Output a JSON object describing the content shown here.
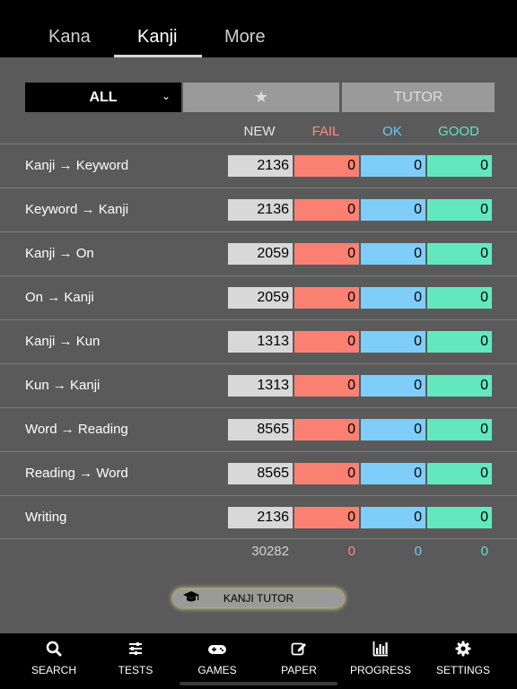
{
  "tabs": [
    {
      "label": "Kana"
    },
    {
      "label": "Kanji"
    },
    {
      "label": "More"
    }
  ],
  "filters": {
    "all_label": "ALL",
    "star_label": "★",
    "tutor_label": "TUTOR"
  },
  "columns": {
    "new": "NEW",
    "fail": "FAIL",
    "ok": "OK",
    "good": "GOOD"
  },
  "rows": [
    {
      "label": "Kanji → Keyword",
      "new": "2136",
      "fail": "0",
      "ok": "0",
      "good": "0"
    },
    {
      "label": "Keyword → Kanji",
      "new": "2136",
      "fail": "0",
      "ok": "0",
      "good": "0"
    },
    {
      "label": "Kanji → On",
      "new": "2059",
      "fail": "0",
      "ok": "0",
      "good": "0"
    },
    {
      "label": "On → Kanji",
      "new": "2059",
      "fail": "0",
      "ok": "0",
      "good": "0"
    },
    {
      "label": "Kanji → Kun",
      "new": "1313",
      "fail": "0",
      "ok": "0",
      "good": "0"
    },
    {
      "label": "Kun → Kanji",
      "new": "1313",
      "fail": "0",
      "ok": "0",
      "good": "0"
    },
    {
      "label": "Word → Reading",
      "new": "8565",
      "fail": "0",
      "ok": "0",
      "good": "0"
    },
    {
      "label": "Reading → Word",
      "new": "8565",
      "fail": "0",
      "ok": "0",
      "good": "0"
    },
    {
      "label": "Writing",
      "new": "2136",
      "fail": "0",
      "ok": "0",
      "good": "0"
    }
  ],
  "totals": {
    "new": "30282",
    "fail": "0",
    "ok": "0",
    "good": "0"
  },
  "tutor_button": {
    "label": "KANJI TUTOR",
    "icon": "graduation-cap-icon"
  },
  "nav": [
    {
      "label": "SEARCH",
      "icon": "search-icon"
    },
    {
      "label": "TESTS",
      "icon": "sliders-icon"
    },
    {
      "label": "GAMES",
      "icon": "gamepad-icon"
    },
    {
      "label": "PAPER",
      "icon": "pencil-square-icon"
    },
    {
      "label": "PROGRESS",
      "icon": "bar-chart-icon"
    },
    {
      "label": "SETTINGS",
      "icon": "gear-icon"
    }
  ],
  "colors": {
    "fail": "#fa8072",
    "ok": "#7fcef9",
    "good": "#63e8bd",
    "new": "#d8d8d8"
  }
}
